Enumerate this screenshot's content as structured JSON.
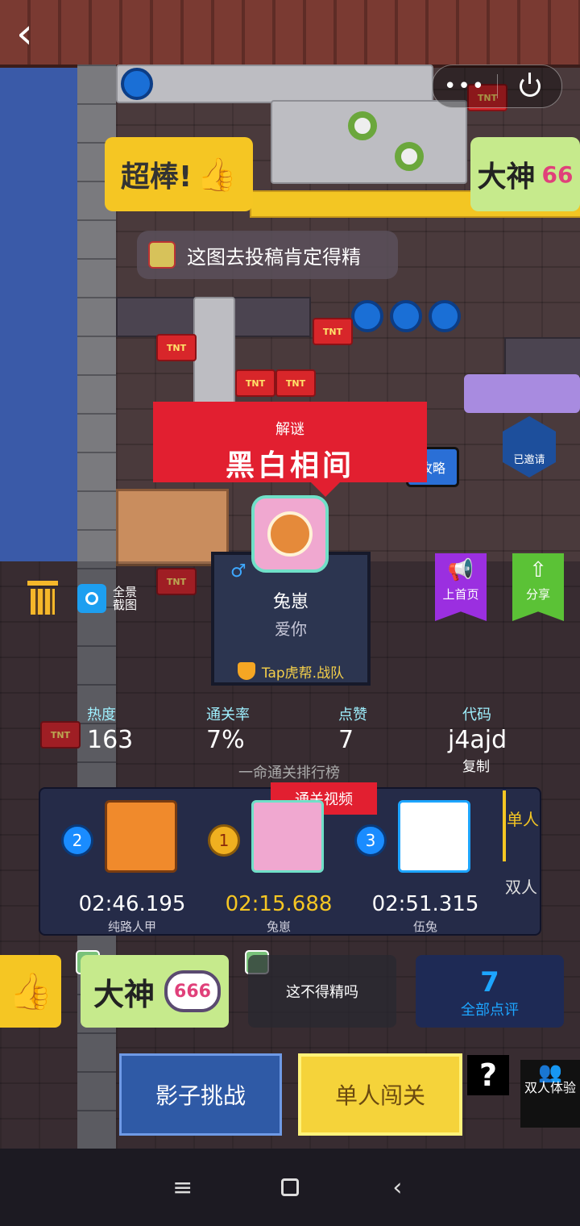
{
  "top": {
    "back_icon": "chevron-left-icon",
    "menu_dots": "•••",
    "close_icon": "power-icon"
  },
  "scene": {
    "sticker_great": "超棒!",
    "sticker_dashen": "大神",
    "sticker_dashen_num": "66",
    "tnt_label": "TNT",
    "chat_bubble": "这图去投稿肯定得精",
    "guide_label": "攻略",
    "invited_label": "已邀请"
  },
  "level": {
    "category": "解谜",
    "title": "黑白相间",
    "author_name": "兔崽",
    "author_motto": "爱你",
    "team": "Tap虎帮.战队"
  },
  "side": {
    "pano_label": "全景截图",
    "front_page_label": "上首页",
    "share_label": "分享"
  },
  "stats": {
    "heat_label": "热度",
    "heat_value": "163",
    "pass_label": "通关率",
    "pass_value": "7%",
    "like_label": "点赞",
    "like_value": "7",
    "code_label": "代码",
    "code_value": "j4ajd",
    "copy_label": "复制"
  },
  "leaderboard": {
    "header": "一命通关排行榜",
    "video_tag": "通关视频",
    "entries": [
      {
        "rank": "2",
        "time": "02:46.195",
        "name": "纯路人甲"
      },
      {
        "rank": "1",
        "time": "02:15.688",
        "name": "兔崽"
      },
      {
        "rank": "3",
        "time": "02:51.315",
        "name": "伍兔"
      }
    ],
    "mode_single": "单人",
    "mode_double": "双人"
  },
  "comments": {
    "dashen_text": "大神",
    "dashen_num": "666",
    "text_comment": "这不得精吗",
    "all_count": "7",
    "all_label": "全部点评"
  },
  "actions": {
    "shadow_challenge": "影子挑战",
    "solo_run": "单人闯关",
    "help": "?",
    "duo_label": "双人体验"
  },
  "colors": {
    "accent_yellow": "#f5c623",
    "banner_red": "#e21f30",
    "purple_ribbon": "#9b2fe0",
    "green_ribbon": "#5bc236",
    "board_bg": "#252b48"
  }
}
